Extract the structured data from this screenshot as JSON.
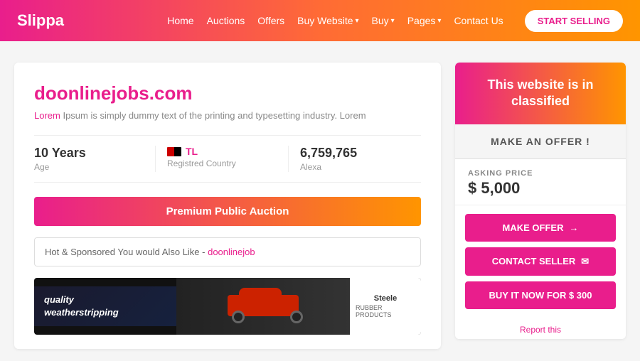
{
  "header": {
    "logo": "Slippa",
    "nav": [
      {
        "label": "Home",
        "has_dropdown": false
      },
      {
        "label": "Auctions",
        "has_dropdown": false
      },
      {
        "label": "Offers",
        "has_dropdown": false
      },
      {
        "label": "Buy Website",
        "has_dropdown": true
      },
      {
        "label": "Buy",
        "has_dropdown": true
      },
      {
        "label": "Pages",
        "has_dropdown": true
      },
      {
        "label": "Contact Us",
        "has_dropdown": false
      }
    ],
    "cta_label": "START SELLING"
  },
  "left": {
    "site_title": "doonlinejobs.com",
    "description_prefix": "Lorem ",
    "description": "Ipsum is simply dummy text of the printing and typesetting industry. Lorem",
    "stats": [
      {
        "value": "10 Years",
        "label": "Age"
      },
      {
        "country_code": "TL",
        "label": "Registred Country"
      },
      {
        "value": "6,759,765",
        "label": "Alexa"
      }
    ],
    "auction_btn": "Premium Public Auction",
    "sponsored_text": "Hot & Sponsored You would Also Like - ",
    "sponsored_link": "doonlinejob",
    "ad": {
      "left_text": "quality\nweatherstripping",
      "logo_name": "Steele",
      "logo_sub": "RUBBER PRODUCTS"
    }
  },
  "right": {
    "classified_text": "This website is in classified",
    "make_offer_btn": "MAKE AN OFFER !",
    "asking_label": "ASKING PRICE",
    "asking_price": "$ 5,000",
    "make_offer_action": "MAKE OFFER",
    "contact_seller": "CONTACT SELLER",
    "buy_now": "BUY IT NOW FOR $ 300",
    "report": "Report this"
  }
}
